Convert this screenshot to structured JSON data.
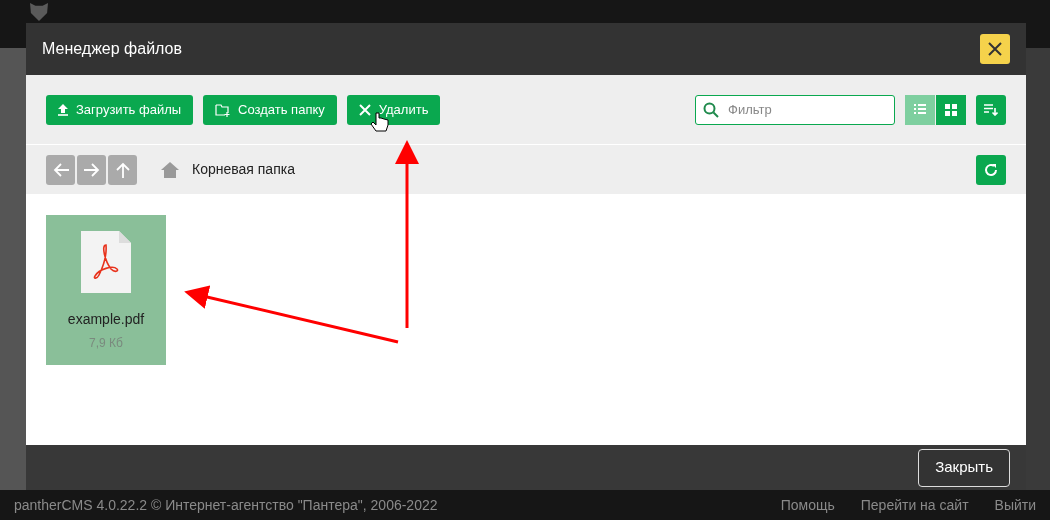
{
  "dialog": {
    "title": "Менеджер файлов"
  },
  "toolbar": {
    "buttons": [
      {
        "label": "Загрузить файлы",
        "kind": "upload"
      },
      {
        "label": "Создать папку",
        "kind": "folder"
      },
      {
        "label": "Удалить",
        "kind": "delete"
      }
    ],
    "filter": {
      "placeholder": "Фильтр"
    },
    "view_modes": [
      {
        "kind": "list",
        "selected": false
      },
      {
        "kind": "grid",
        "selected": true
      }
    ]
  },
  "navigation": [
    {
      "kind": "back",
      "disabled": true
    },
    {
      "kind": "forward",
      "disabled": true
    },
    {
      "kind": "up",
      "disabled": true
    }
  ],
  "breadcrumb": {
    "path": "Корневая папка"
  },
  "files": [
    {
      "name": "example.pdf",
      "size": "7,9 Кб",
      "selected": true
    }
  ],
  "close_button": "Закрыть",
  "page_footer": {
    "copyright": "pantherCMS 4.0.22.2 © Интернет-агентство \"Пантера\", 2006-2022",
    "links": [
      "Помощь",
      "Перейти на сайт",
      "Выйти"
    ]
  }
}
